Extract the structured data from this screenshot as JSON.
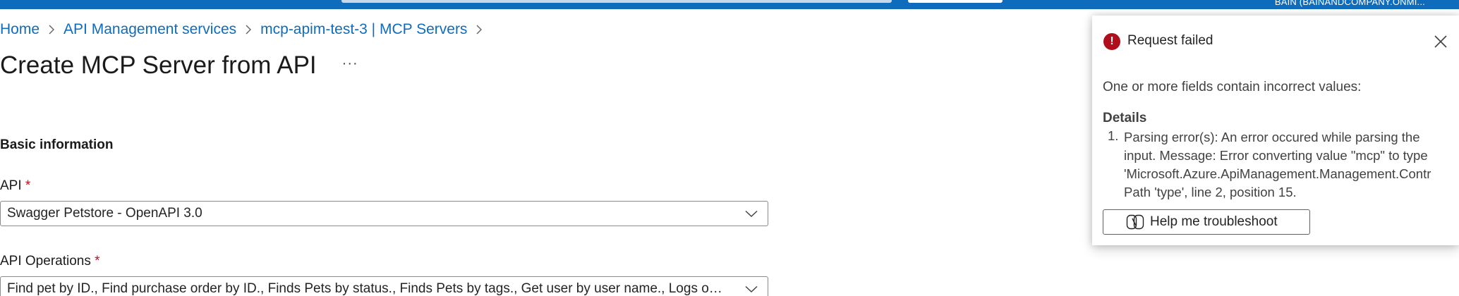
{
  "header": {
    "account": "BAIN (BAINANDCOMPANY.ONMI..."
  },
  "breadcrumb": [
    {
      "label": "Home"
    },
    {
      "label": "API Management services"
    },
    {
      "label": "mcp-apim-test-3 | MCP Servers"
    }
  ],
  "page": {
    "title": "Create MCP Server from API",
    "more_label": "···"
  },
  "form": {
    "section_title": "Basic information",
    "required_marker": "*",
    "api": {
      "label": "API",
      "value": "Swagger Petstore - OpenAPI 3.0"
    },
    "operations": {
      "label": "API Operations",
      "value": "Find pet by ID., Find purchase order by ID., Finds Pets by status., Finds Pets by tags., Get user by user name., Logs out c..."
    }
  },
  "toast": {
    "title": "Request failed",
    "message": "One or more fields contain incorrect values:",
    "details_heading": "Details",
    "details_number": "1.",
    "details_lines": [
      "Parsing error(s): An error occured while parsing the",
      "input. Message: Error converting value \"mcp\" to type",
      "'Microsoft.Azure.ApiManagement.Management.Contr",
      "Path 'type', line 2, position 15."
    ],
    "help_button": "Help me troubleshoot",
    "icons": {
      "status": "error-icon",
      "close": "close-icon",
      "help": "copilot-icon"
    },
    "colors": {
      "error": "#b10e1c",
      "link": "#0f6cbd",
      "required": "#c50f1f",
      "topbar": "#0f6cbd"
    }
  }
}
